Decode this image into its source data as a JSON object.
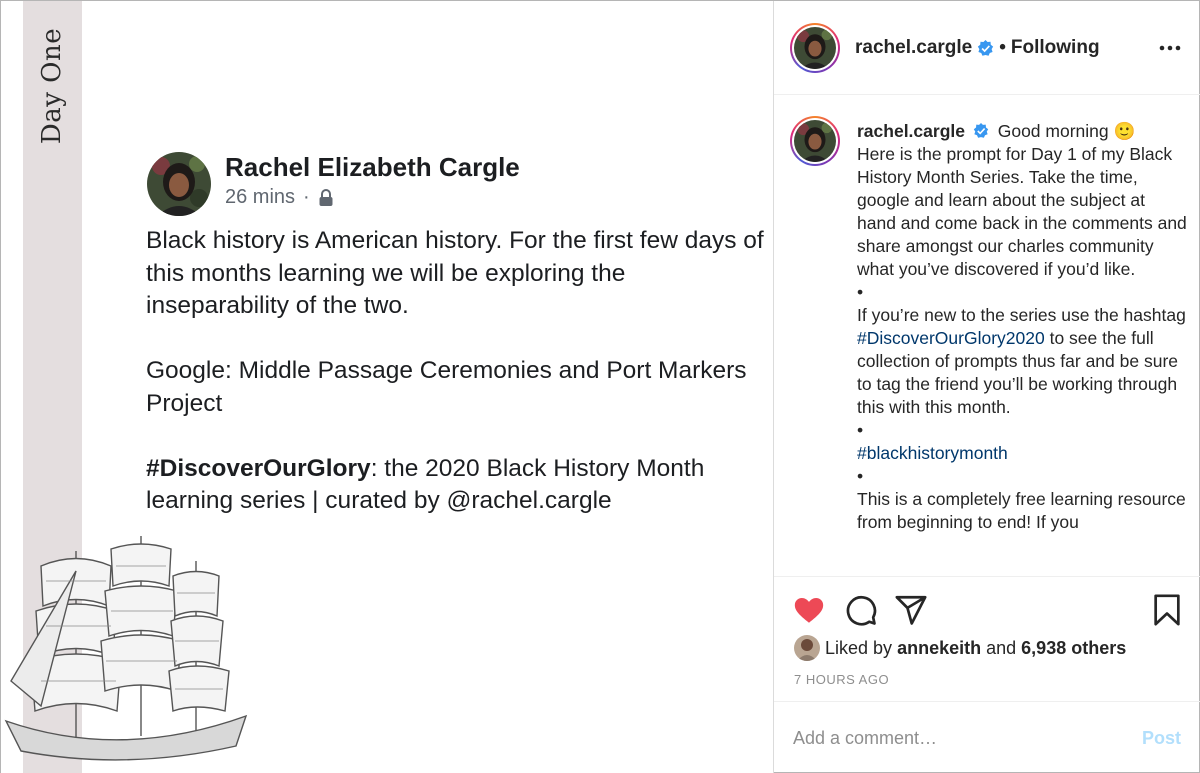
{
  "image": {
    "side_label": "Day One",
    "fb_post": {
      "author": "Rachel Elizabeth Cargle",
      "time": "26 mins",
      "separator": "·",
      "paragraph1": "Black history is American history. For the first few days of this months learning we will be exploring the inseparability of the two.",
      "paragraph2": "Google: Middle Passage Ceremonies and Port Markers Project",
      "hashtag_bold": "#DiscoverOurGlory",
      "paragraph3_rest": ": the 2020 Black History Month learning series | curated by @rachel.cargle"
    }
  },
  "header": {
    "username": "rachel.cargle",
    "dot": "•",
    "follow_label": "Following",
    "more_icon": "more-horizontal-icon"
  },
  "caption": {
    "username": "rachel.cargle",
    "greeting": "Good morning 🙂",
    "text1": "Here is the prompt for Day 1 of my Black History Month Series. Take the time, google and learn about the subject at hand and come back in the comments and share amongst our charles community what you’ve discovered if you’d like.",
    "bullet1": "•",
    "text2_before": "If you’re new to the series use the hashtag ",
    "hashtag1": "#DiscoverOurGlory2020",
    "text2_after": " to see the full collection of prompts thus far and be sure to tag the friend you’ll be working through this with this month.",
    "bullet2": "•",
    "hashtag2": "#blackhistorymonth",
    "bullet3": "•",
    "text3": "This is a completely free learning resource from beginning to end! If you"
  },
  "actions": {
    "like_icon": "heart-filled-icon",
    "comment_icon": "comment-icon",
    "share_icon": "share-icon",
    "save_icon": "bookmark-icon",
    "liked_prefix": "Liked by",
    "liked_user": "annekeith",
    "liked_and": "and",
    "liked_others": "6,938 others",
    "time_ago": "7 HOURS AGO"
  },
  "comment": {
    "placeholder": "Add a comment…",
    "post_label": "Post"
  },
  "colors": {
    "like_red": "#ed4956",
    "hashtag_blue": "#00376b",
    "verified_blue": "#3897f0",
    "post_disabled": "#b2dffc",
    "strip": "#e4dedf"
  }
}
